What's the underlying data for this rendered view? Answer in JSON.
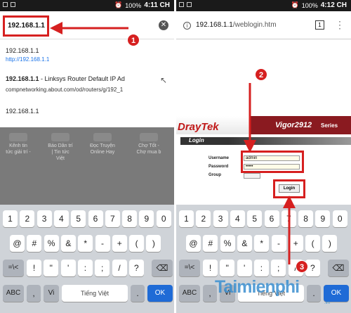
{
  "left": {
    "status": {
      "battery": "100%",
      "time": "4:11 CH"
    },
    "url": "192.168.1.1",
    "clear_icon": "✕",
    "suggestions": [
      {
        "text": "192.168.1.1",
        "sub": "http://192.168.1.1"
      },
      {
        "bold": "192.168.1.1",
        "rest": " - Linksys Router Default IP Ad",
        "sub": "compnetworking.about.com/od/routers/g/192_1",
        "arrow": "↖"
      },
      {
        "text": "192.168.1.1"
      }
    ],
    "tiles": [
      {
        "label": "Kênh tin tức giải trí -"
      },
      {
        "label": "Báo Dân trí | Tin tức Việt"
      },
      {
        "label": "Đọc Truyện Online Hay"
      },
      {
        "label": "Chợ Tốt - Chợ mua b"
      }
    ]
  },
  "right": {
    "status": {
      "battery": "100%",
      "time": "4:12 CH"
    },
    "url_host": "192.168.1.1",
    "url_path": "/weblogin.htm",
    "tab_count": "1",
    "logo": "DrayTek",
    "model": "Vigor2912",
    "series": "Series",
    "login_title": "Login",
    "form": {
      "username_label": "Username",
      "username_value": "admin",
      "password_label": "Password",
      "password_value": "•••••",
      "group_label": "Group"
    },
    "login_button": "Login"
  },
  "keyboard": {
    "row1": [
      "1",
      "2",
      "3",
      "4",
      "5",
      "6",
      "7",
      "8",
      "9",
      "0"
    ],
    "row2": [
      "@",
      "#",
      "%",
      "&",
      "*",
      "-",
      "+",
      "(",
      ")"
    ],
    "row3": [
      "=\\<",
      "!",
      "\"",
      "'",
      ":",
      ";",
      "/",
      "?"
    ],
    "row4": [
      "ABC",
      ",",
      "Vi",
      "Tiếng Việt",
      ".",
      "OK"
    ],
    "backspace": "⌫"
  },
  "steps": [
    "1",
    "2",
    "3"
  ],
  "watermark": "Taimienphi",
  "watermark_sub": ".vn"
}
